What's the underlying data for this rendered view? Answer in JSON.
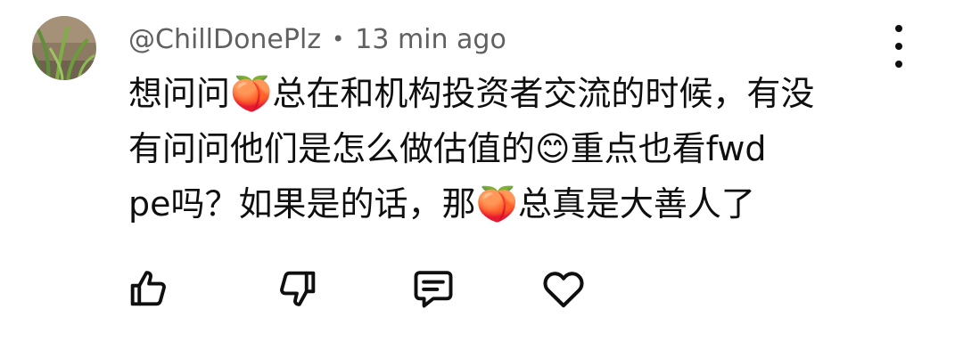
{
  "comment": {
    "author": "@ChillDonePlz",
    "separator": "•",
    "timestamp": "13 min ago",
    "avatar_icon": "grass-avatar",
    "menu_icon": "more-vertical-icon",
    "text_lines": [
      "想问问🍑总在和机构投资者交流的时候，有没",
      "有问问他们是怎么做估值的😊重点也看fwd",
      "pe吗？如果是的话，那🍑总真是大善人了"
    ]
  },
  "actions": {
    "like_icon": "thumbs-up-icon",
    "dislike_icon": "thumbs-down-icon",
    "reply_icon": "comment-icon",
    "heart_icon": "heart-icon"
  }
}
